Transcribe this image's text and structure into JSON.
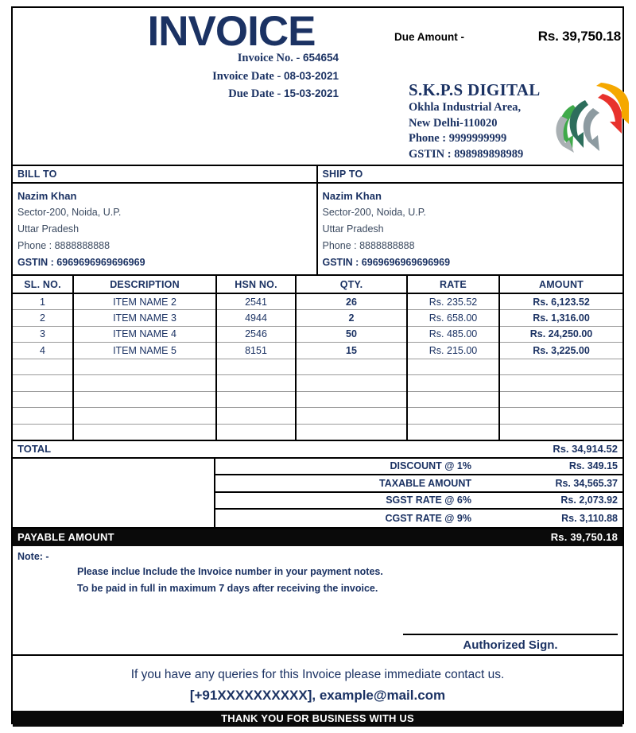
{
  "header": {
    "title": "INVOICE",
    "meta": [
      {
        "label": "Invoice No. -",
        "value": "654654"
      },
      {
        "label": "Invoice Date -",
        "value": "08-03-2021"
      },
      {
        "label": "Due Date -",
        "value": "15-03-2021"
      }
    ],
    "due_amount_label": "Due Amount -",
    "due_amount_value": "Rs. 39,750.18"
  },
  "company": {
    "name": "S.K.P.S DIGITAL",
    "address_line1": "Okhla Industrial Area,",
    "address_line2": "New Delhi-110020",
    "phone": "Phone : 9999999999",
    "gstin": "GSTIN : 898989898989"
  },
  "bill_to": {
    "heading": "BILL TO",
    "name": "Nazim Khan",
    "address": "Sector-200, Noida, U.P.",
    "state": "Uttar Pradesh",
    "phone": "Phone : 8888888888",
    "gstin": "GSTIN : 6969696969696969"
  },
  "ship_to": {
    "heading": "SHIP TO",
    "name": "Nazim Khan",
    "address": "Sector-200, Noida, U.P.",
    "state": "Uttar Pradesh",
    "phone": "Phone : 8888888888",
    "gstin": "GSTIN : 6969696969696969"
  },
  "items_table": {
    "columns": [
      "SL. NO.",
      "DESCRIPTION",
      "HSN NO.",
      "QTY.",
      "RATE",
      "AMOUNT"
    ],
    "rows": [
      {
        "sl": "1",
        "description": "ITEM NAME 2",
        "hsn": "2541",
        "qty": "26",
        "rate": "Rs. 235.52",
        "amount": "Rs. 6,123.52"
      },
      {
        "sl": "2",
        "description": "ITEM NAME 3",
        "hsn": "4944",
        "qty": "2",
        "rate": "Rs. 658.00",
        "amount": "Rs. 1,316.00"
      },
      {
        "sl": "3",
        "description": "ITEM NAME 4",
        "hsn": "2546",
        "qty": "50",
        "rate": "Rs. 485.00",
        "amount": "Rs. 24,250.00"
      },
      {
        "sl": "4",
        "description": "ITEM NAME 5",
        "hsn": "8151",
        "qty": "15",
        "rate": "Rs. 215.00",
        "amount": "Rs. 3,225.00"
      }
    ],
    "empty_row_count": 5
  },
  "totals": {
    "total_label": "TOTAL",
    "total_value": "Rs. 34,914.52",
    "lines": [
      {
        "label": "DISCOUNT @ 1%",
        "value": "Rs. 349.15"
      },
      {
        "label": "TAXABLE AMOUNT",
        "value": "Rs. 34,565.37"
      },
      {
        "label": "SGST RATE @  6%",
        "value": "Rs. 2,073.92"
      },
      {
        "label": "CGST RATE @ 9%",
        "value": "Rs. 3,110.88"
      }
    ],
    "payable_label": "PAYABLE AMOUNT",
    "payable_value": "Rs. 39,750.18"
  },
  "notes": {
    "heading": "Note: -",
    "line1": "Please inclue Include the Invoice number in your payment notes.",
    "line2": "To be paid in full in maximum 7 days after receiving the invoice.",
    "sign_label": "Authorized Sign."
  },
  "footer": {
    "queries": "If you have any queries for this Invoice  please immediate contact us.",
    "contact": "[+91XXXXXXXXXX], example@mail.com",
    "thanks": "THANK YOU FOR BUSINESS WITH US"
  },
  "colors": {
    "navy": "#1b3263",
    "black_bar": "#0a0a0a",
    "muted_text": "#3b4a60"
  }
}
